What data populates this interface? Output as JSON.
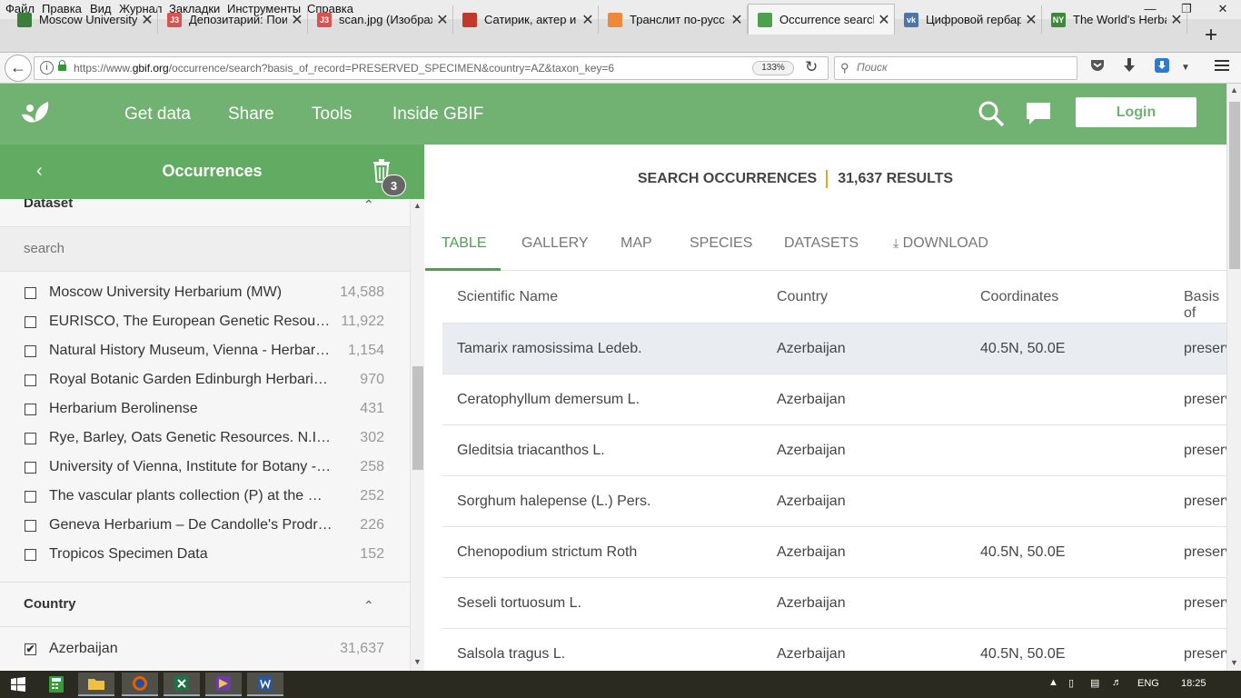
{
  "menubar": {
    "items": [
      "Файл",
      "Правка",
      "Вид",
      "Журнал",
      "Закладки",
      "Инструменты",
      "Справка"
    ],
    "win_controls": [
      "—",
      "❐",
      "✕"
    ]
  },
  "tabs": [
    {
      "label": "Moscow University",
      "icon_color": "#3b7d3b",
      "icon_text": "",
      "active": false
    },
    {
      "label": "Депозитарий: Пои",
      "icon_color": "#d9534f",
      "icon_text": "J3",
      "active": false
    },
    {
      "label": "scan.jpg (Изображ",
      "icon_color": "#d9534f",
      "icon_text": "J3",
      "active": false
    },
    {
      "label": "Сатирик, актер и р",
      "icon_color": "#c0392b",
      "icon_text": "",
      "active": false
    },
    {
      "label": "Транслит по-русс",
      "icon_color": "#f0883a",
      "icon_text": "",
      "active": false
    },
    {
      "label": "Occurrence search",
      "icon_color": "#4da04d",
      "icon_text": "",
      "active": true
    },
    {
      "label": "Цифровой гербар",
      "icon_color": "#4a76a8",
      "icon_text": "vk",
      "active": false
    },
    {
      "label": "The World's Herba",
      "icon_color": "#3a8a3a",
      "icon_text": "NY",
      "active": false
    }
  ],
  "new_tab_label": "+",
  "tab_close": "✕",
  "nav": {
    "url_prefix": "https://www.",
    "url_host": "gbif.org",
    "url_rest": "/occurrence/search?basis_of_record=PRESERVED_SPECIMEN&country=AZ&taxon_key=6",
    "zoom": "133%",
    "search_placeholder": "Поиск"
  },
  "gbif": {
    "nav_items": [
      "Get data",
      "Share",
      "Tools",
      "Inside GBIF"
    ],
    "login": "Login",
    "brand_color": "#71b171"
  },
  "sidebar": {
    "title": "Occurrences",
    "badge": "3",
    "dataset_title": "Dataset",
    "search_placeholder": "search",
    "datasets": [
      {
        "name": "Moscow University Herbarium (MW)",
        "count": "14,588",
        "checked": false
      },
      {
        "name": "EURISCO, The European Genetic Resources Search Catalogue",
        "count": "11,922",
        "checked": false
      },
      {
        "name": "Natural History Museum, Vienna - Herbarium W",
        "count": "1,154",
        "checked": false
      },
      {
        "name": "Royal Botanic Garden Edinburgh Herbarium (E)",
        "count": "970",
        "checked": false
      },
      {
        "name": "Herbarium Berolinense",
        "count": "431",
        "checked": false
      },
      {
        "name": "Rye, Barley, Oats Genetic Resources. N.I.Vavilov",
        "count": "302",
        "checked": false
      },
      {
        "name": "University of Vienna, Institute for Botany - Herbarium WU",
        "count": "258",
        "checked": false
      },
      {
        "name": "The vascular plants collection (P) at the Herbarium",
        "count": "252",
        "checked": false
      },
      {
        "name": "Geneva Herbarium – De Candolle's Prodromus",
        "count": "226",
        "checked": false
      },
      {
        "name": "Tropicos Specimen Data",
        "count": "152",
        "checked": false
      }
    ],
    "country_title": "Country",
    "countries": [
      {
        "name": "Azerbaijan",
        "count": "31,637",
        "checked": true
      }
    ]
  },
  "main": {
    "heading": "SEARCH OCCURRENCES",
    "results": "31,637 RESULTS",
    "tabs": [
      "TABLE",
      "GALLERY",
      "MAP",
      "SPECIES",
      "DATASETS",
      "DOWNLOAD"
    ],
    "active_tab": "TABLE",
    "columns": [
      "Scientific Name",
      "Country",
      "Coordinates",
      "Basis of record"
    ],
    "rows": [
      {
        "name": "Tamarix ramosissima Ledeb.",
        "country": "Azerbaijan",
        "coords": "40.5N, 50.0E",
        "basis": "preserved specimen"
      },
      {
        "name": "Ceratophyllum demersum L.",
        "country": "Azerbaijan",
        "coords": "",
        "basis": "preserved specimen"
      },
      {
        "name": "Gleditsia triacanthos L.",
        "country": "Azerbaijan",
        "coords": "",
        "basis": "preserved specimen"
      },
      {
        "name": "Sorghum halepense (L.) Pers.",
        "country": "Azerbaijan",
        "coords": "",
        "basis": "preserved specimen"
      },
      {
        "name": "Chenopodium strictum Roth",
        "country": "Azerbaijan",
        "coords": "40.5N, 50.0E",
        "basis": "preserved specimen"
      },
      {
        "name": "Seseli tortuosum L.",
        "country": "Azerbaijan",
        "coords": "",
        "basis": "preserved specimen"
      },
      {
        "name": "Salsola tragus L.",
        "country": "Azerbaijan",
        "coords": "40.5N, 50.0E",
        "basis": "preserved specimen"
      }
    ]
  },
  "taskbar": {
    "apps": [
      "start",
      "calc",
      "explorer",
      "firefox",
      "excel",
      "media",
      "word"
    ],
    "lang": "ENG",
    "time": "18:25"
  }
}
